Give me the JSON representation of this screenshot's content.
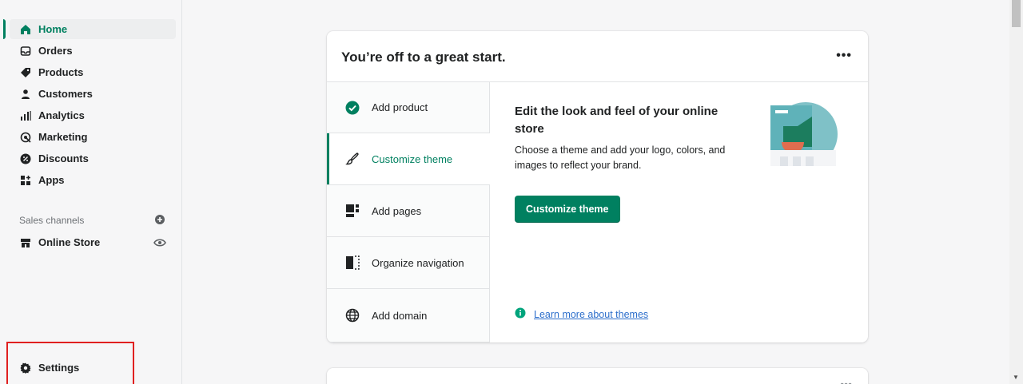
{
  "sidebar": {
    "items": [
      {
        "label": "Home",
        "icon": "home-icon"
      },
      {
        "label": "Orders",
        "icon": "orders-icon"
      },
      {
        "label": "Products",
        "icon": "tag-icon"
      },
      {
        "label": "Customers",
        "icon": "person-icon"
      },
      {
        "label": "Analytics",
        "icon": "analytics-icon"
      },
      {
        "label": "Marketing",
        "icon": "marketing-icon"
      },
      {
        "label": "Discounts",
        "icon": "discount-icon"
      },
      {
        "label": "Apps",
        "icon": "apps-icon"
      }
    ],
    "sales_channels_label": "Sales channels",
    "online_store_label": "Online Store",
    "settings_label": "Settings"
  },
  "setup_card": {
    "title": "You’re off to a great start.",
    "more": "•••",
    "steps": [
      {
        "label": "Add product",
        "icon": "check-circle-icon"
      },
      {
        "label": "Customize theme",
        "icon": "brush-icon"
      },
      {
        "label": "Add pages",
        "icon": "pages-icon"
      },
      {
        "label": "Organize navigation",
        "icon": "navigation-icon"
      },
      {
        "label": "Add domain",
        "icon": "globe-icon"
      }
    ],
    "detail": {
      "title": "Edit the look and feel of your online store",
      "description": "Choose a theme and add your logo, colors, and images to reflect your brand.",
      "button_label": "Customize theme",
      "link_label": "Learn more about themes"
    }
  },
  "second_card": {
    "more": "•••"
  },
  "colors": {
    "accent": "#008060",
    "link": "#2c6ecb",
    "highlight": "#e02020"
  }
}
